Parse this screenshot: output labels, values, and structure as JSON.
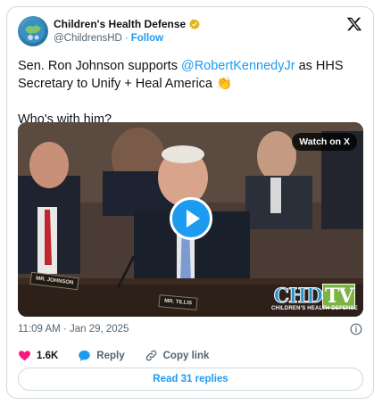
{
  "author": {
    "display_name": "Children's Health Defense",
    "handle": "@ChildrensHD",
    "separator": "·",
    "follow_label": "Follow"
  },
  "tweet": {
    "text_before_mention": "Sen. Ron Johnson supports ",
    "mention": "@RobertKennedyJr",
    "text_after_mention": " as HHS Secretary to Unify + Heal America 👏",
    "line2": "Who's with him?"
  },
  "media": {
    "watch_label": "Watch on X",
    "plate_left": "MR. JOHNSON",
    "plate_right": "MR. TILLIS",
    "logo_chd": "CHD",
    "logo_tv": "TV",
    "logo_sub": "CHILDREN'S HEALTH DEFENSE"
  },
  "meta": {
    "timestamp": "11:09 AM · Jan 29, 2025"
  },
  "actions": {
    "like_count": "1.6K",
    "reply_label": "Reply",
    "copy_link_label": "Copy link"
  },
  "footer": {
    "read_replies_label": "Read 31 replies"
  },
  "colors": {
    "accent": "#1d9bf0",
    "like": "#f91880",
    "verified": "#e2b719",
    "secondary_text": "#536471"
  },
  "icons": [
    "verified-badge-icon",
    "x-logo-icon",
    "play-icon",
    "info-icon",
    "heart-icon",
    "reply-bubble-icon",
    "link-icon"
  ]
}
